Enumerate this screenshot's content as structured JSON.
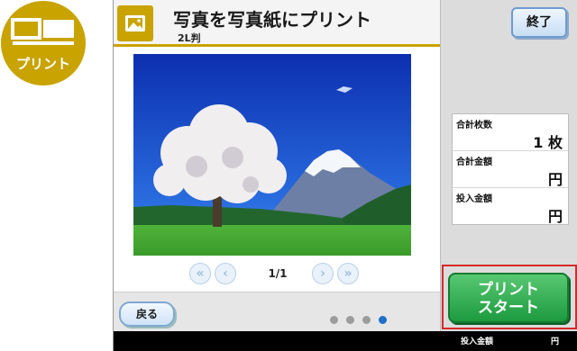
{
  "badge": {
    "label": "プリント",
    "icon": "print-badge-icon",
    "color": "#c9a300"
  },
  "header": {
    "icon": "photo-icon",
    "title": "写真を写真紙にプリント",
    "subtitle": "2L判"
  },
  "pager": {
    "page_indicator": "1/1",
    "first_icon": "double-chevron-left-icon",
    "prev_icon": "chevron-left-icon",
    "next_icon": "chevron-right-icon",
    "last_icon": "double-chevron-right-icon"
  },
  "bottom": {
    "back_label": "戻る",
    "dots_total": 4,
    "dots_active_index": 3
  },
  "side": {
    "end_label": "終了",
    "total_count_label": "合計枚数",
    "total_count_value": "1 枚",
    "total_amount_label": "合計金額",
    "total_amount_value": "円",
    "deposit_label": "投入金額",
    "deposit_value": "円",
    "start_label_line1": "プリント",
    "start_label_line2": "スタート"
  },
  "status": {
    "deposit_label": "投入金額",
    "unit": "円"
  },
  "colors": {
    "accent_gold": "#c9a300",
    "start_green": "#1d9a3f",
    "highlight_red": "#d62a2a",
    "active_dot": "#1f6fc6"
  }
}
